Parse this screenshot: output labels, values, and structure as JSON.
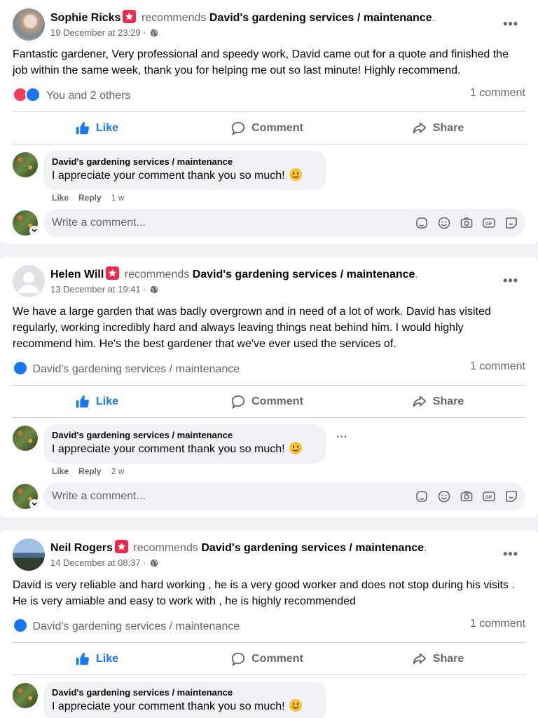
{
  "posts": [
    {
      "author": "Sophie Ricks",
      "recommends": "recommends",
      "page": "David's gardening services / maintenance",
      "period": ".",
      "time": "19 December at 23:29 ·",
      "text": "Fantastic gardener, Very professional and speedy work, David came out for a quote and finished the job within the same week, thank you for helping me out so last minute! Highly recommend.",
      "reactions_label": "You and 2 others",
      "comment_count": "1 comment",
      "actions": {
        "like": "Like",
        "comment": "Comment",
        "share": "Share"
      },
      "reply": {
        "name": "David's gardening services / maintenance",
        "text": "I appreciate your comment thank you so much!",
        "like": "Like",
        "reply": "Reply",
        "age": "1 w"
      },
      "write_placeholder": "Write a comment..."
    },
    {
      "author": "Helen Will",
      "recommends": "recommends",
      "page": "David's gardening services / maintenance",
      "period": ".",
      "time": "13 December at 19:41 ·",
      "text": "We have a large garden that was badly overgrown and in need of a lot of work. David has visited regularly, working incredibly hard and always leaving things neat behind him. I would highly recommend him. He's the best gardener that we've ever used the services of.",
      "reactions_label": "David's gardening services / maintenance",
      "comment_count": "1 comment",
      "actions": {
        "like": "Like",
        "comment": "Comment",
        "share": "Share"
      },
      "reply": {
        "name": "David's gardening services / maintenance",
        "text": "I appreciate your comment thank you so much!",
        "like": "Like",
        "reply": "Reply",
        "age": "2 w"
      },
      "write_placeholder": "Write a comment..."
    },
    {
      "author": "Neil Rogers",
      "recommends": "recommends",
      "page": "David's gardening services / maintenance",
      "period": ".",
      "time": "14 December at 08:37 ·",
      "text": "David is very reliable and hard working , he is a very good worker and does not stop during his visits . He is very amiable and easy to work with  , he is highly recommended",
      "reactions_label": "David's gardening services / maintenance",
      "comment_count": "1 comment",
      "actions": {
        "like": "Like",
        "comment": "Comment",
        "share": "Share"
      },
      "reply": {
        "name": "David's gardening services / maintenance",
        "text": "I appreciate your comment thank you so much!"
      }
    }
  ],
  "icons": {
    "more": "more-options-icon",
    "globe": "globe-icon",
    "recommend_badge": "recommend-star-badge-icon",
    "like": "thumbs-up-icon",
    "comment": "speech-bubble-icon",
    "share": "share-arrow-icon",
    "write_tools": [
      "avatar-sticker-icon",
      "emoji-icon",
      "camera-icon",
      "gif-icon",
      "sticker-icon"
    ]
  },
  "colors": {
    "accent": "#1877f2",
    "badge": "#f02849",
    "heart": "#f33e58",
    "muted": "#65676b"
  }
}
